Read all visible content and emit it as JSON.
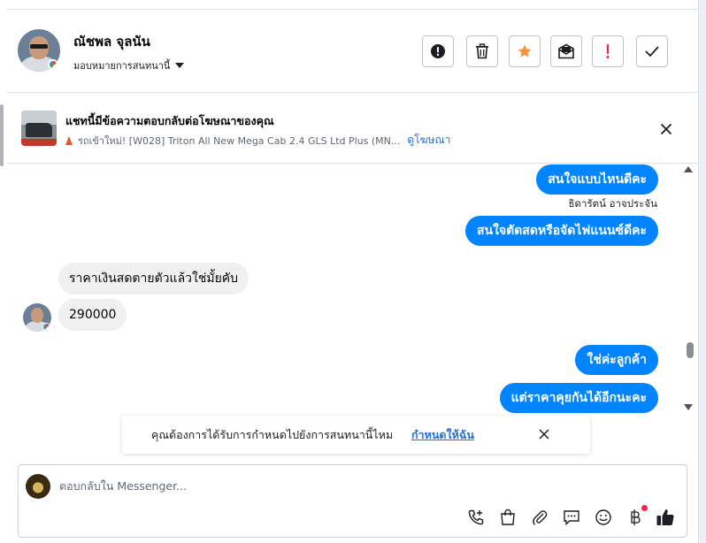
{
  "header": {
    "contact_name": "ณัชพล จุลนัน",
    "assign_label": "มอบหมายการสนทนานี้"
  },
  "ad_banner": {
    "title": "แชทนี้มีข้อความตอบกลับต่อโฆษณาของคุณ",
    "ad_text": "รถเข้าใหม่! [W028] Triton All New Mega Cab 2.4 GLS Ltd Plus (MN...",
    "see_ad_label": "ดูโฆษณา"
  },
  "messages": [
    {
      "direction": "out",
      "text": "สนใจแบบไหนดีคะ"
    },
    {
      "direction": "sender",
      "text": "ธิดารัตน์ อาจประจัน"
    },
    {
      "direction": "out",
      "text": "สนใจตัดสดหรือจัดไฟแนนซ์ดีคะ"
    },
    {
      "direction": "in",
      "text": "ราคาเงินสดตายตัวแล้วใช่มั้ยคับ"
    },
    {
      "direction": "in",
      "text": "290000"
    },
    {
      "direction": "out",
      "text": "ใช่ค่ะลูกค้า"
    },
    {
      "direction": "out",
      "text": "แต่ราคาคุยกันได้อีกนะคะ"
    }
  ],
  "reminder": {
    "text": "คุณต้องการได้รับการกำหนดไปยังการสนทนานี้ไหม",
    "link": "กำหนดให้ฉัน"
  },
  "composer": {
    "placeholder": "ตอบกลับใน Messenger..."
  },
  "colors": {
    "accent_blue": "#0084ff",
    "link_blue": "#216fdb",
    "star_orange": "#f5923e",
    "flag_red": "#f02849"
  }
}
